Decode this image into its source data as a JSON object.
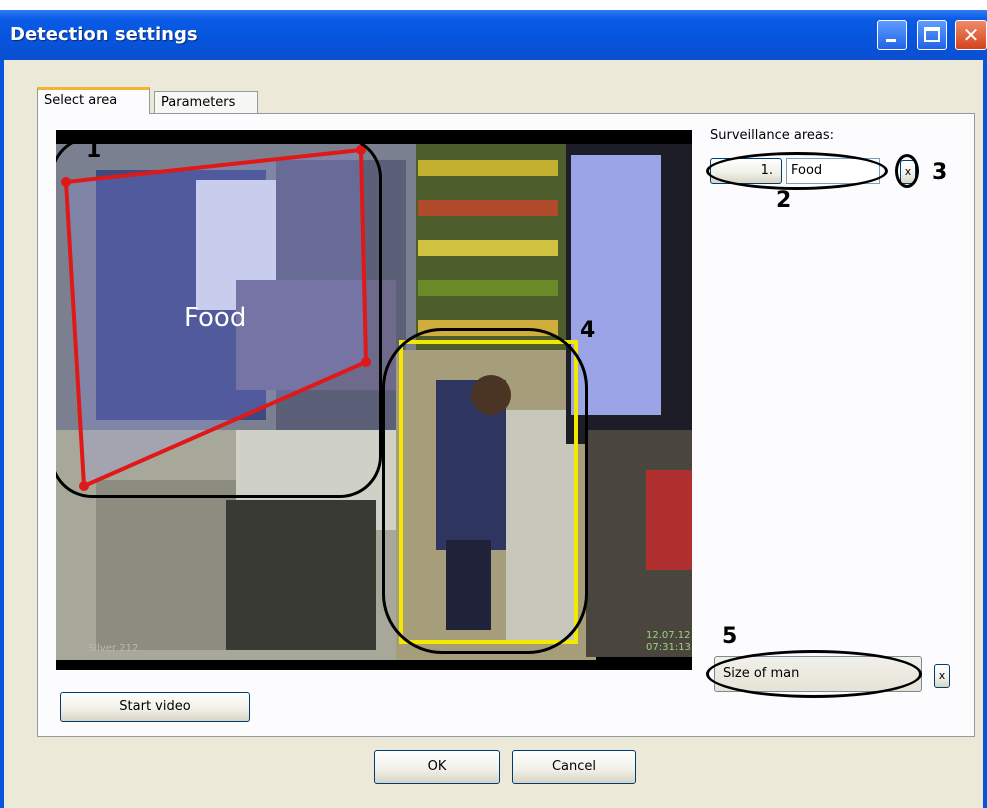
{
  "window": {
    "title": "Detection settings",
    "minimize_icon": "minimize-icon",
    "maximize_icon": "maximize-icon",
    "close_icon": "close-icon"
  },
  "tabs": [
    {
      "label": "Select area",
      "active": true
    },
    {
      "label": "Parameters",
      "active": false
    }
  ],
  "video": {
    "area_label": "Food",
    "timestamp_left": "Silver 212",
    "timestamp_right_line1": "12.07.12",
    "timestamp_right_line2": "07:31:13"
  },
  "surveillance": {
    "label": "Surveillance areas:",
    "areas": [
      {
        "number": "1.",
        "name": "Food",
        "remove_label": "x"
      }
    ],
    "size_of_man_label": "Size of man",
    "size_remove_label": "x"
  },
  "callouts": [
    "1",
    "2",
    "3",
    "4",
    "5"
  ],
  "buttons": {
    "start_video": "Start video",
    "ok": "OK",
    "cancel": "Cancel"
  },
  "colors": {
    "title_bar": "#0754dc",
    "area_outline": "#e01818",
    "man_outline": "#f2e800",
    "dialog_bg": "#ece9d8"
  }
}
